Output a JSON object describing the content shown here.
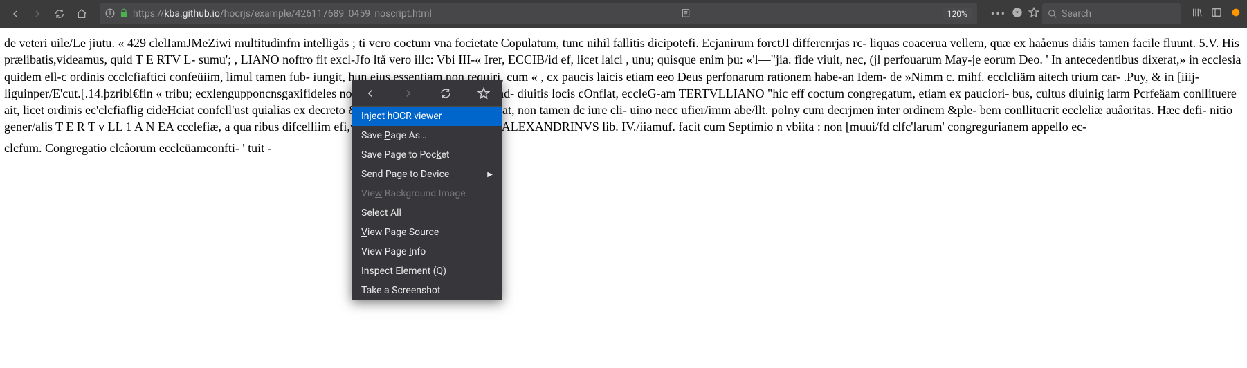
{
  "url": {
    "scheme": "https://",
    "domain": "kba.github.io",
    "path": "/hocrjs/example/426117689_0459_noscript.html"
  },
  "zoom": "120%",
  "search_placeholder": "Search",
  "page_text": {
    "p1": "de veteri uile/Le jiutu. « 429 clelIamJMeZiwi multitudinfm intelligäs ; ti vcro coctum vna focietate Copulatum, tunc nihil fallitis dicipotefi. Ecjanirum forctJI differcnrjas rc- liquas coacerua vellem, quæ ex haåenus diåis tamen facile fluunt. 5.V. His prælibatis,videamus, quid T E RTV L- sumu'; , LIANO noftro fit excl-Jfo ltå vero illc: Vbi III-« Irer, ECCIB/id ef, licet laici , unu; quisque enim þu: «'l—\"jia. fide viuit, nec, (jl perfouarum May-je eorum Deo. ' In antecedentibus dixerat,» in ecclesia quidem ell-c ordinis ccclcfiaftici confeüiim, limul tamen fub- iungit, hun eius essentiam non requiri, cum « , cx paucis laicis etiam eeo Deus perfonarum rationem habe-an Idem- de »Nimm c. mihf. ecclcliäm aitech trium car- .Puy, & in [iiij-liguinper/E'cut.[.14.þzribi€fin « tribu; ecxlengupponcnsgaxifideles non pollint. Interim id fatis ex *ad- diuitis locis cOnflat, eccleG-am TERTVLLIANO \"hic eff coctum congregatum, etiam ex pauciori- bus, cultus diuinig iarm Pcrfeäam conllituere ait, licet ordinis ec'clcfiaflig cideHciat confcll'ust quialias ex decreto & »in rizute fic/We adelTe lbleat, non tamen dc iure cli- uino necc ufier/imm abe/llt. polny cum decrjmen inter ordinem &ple- bem conllitucrit eccleliæ auåoritas. Hæc defi- nitio gener/alis T E R T v LL 1 A N EA ccclefiæ, a qua ribus difcelliim efi,vti infra ottendam. CL EM As ALEXANDRINVS lib. IV./iiamuf. facit cum Septimio n vbiita : non [muui/fd clfc'larum' congregurianem appello ec-",
    "p2": "clcfum. Congregatio clcåorum ecclcüamconfti- ' tuit -"
  },
  "context_menu": {
    "items": [
      {
        "label": "Inject hOCR viewer",
        "underline_idx": -1,
        "highlighted": true,
        "disabled": false,
        "arrow": false
      },
      {
        "label": "Save Page As…",
        "underline_letter": "P",
        "highlighted": false,
        "disabled": false,
        "arrow": false
      },
      {
        "label": "Save Page to Pocket",
        "underline_letter": "k",
        "highlighted": false,
        "disabled": false,
        "arrow": false
      },
      {
        "label": "Send Page to Device",
        "underline_letter": "n",
        "highlighted": false,
        "disabled": false,
        "arrow": true
      },
      {
        "label": "View Background Image",
        "underline_letter": "w",
        "highlighted": false,
        "disabled": true,
        "arrow": false
      },
      {
        "label": "Select All",
        "underline_letter": "A",
        "highlighted": false,
        "disabled": false,
        "arrow": false
      },
      {
        "label": "View Page Source",
        "underline_letter": "V",
        "highlighted": false,
        "disabled": false,
        "arrow": false
      },
      {
        "label": "View Page Info",
        "underline_letter": "I",
        "highlighted": false,
        "disabled": false,
        "arrow": false
      },
      {
        "label": "Inspect Element (Q)",
        "underline_letter": "Q",
        "highlighted": false,
        "disabled": false,
        "arrow": false
      },
      {
        "label": "Take a Screenshot",
        "underline_letter": "",
        "highlighted": false,
        "disabled": false,
        "arrow": false
      }
    ]
  }
}
